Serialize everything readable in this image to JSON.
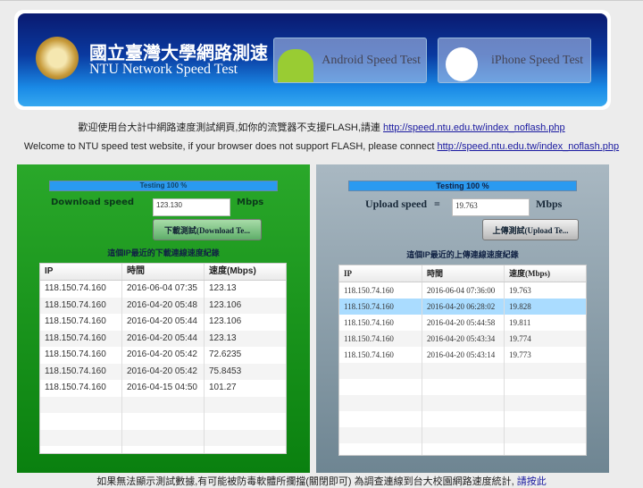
{
  "banner": {
    "title_zh": "國立臺灣大學網路測速",
    "title_en": "NTU Network Speed Test",
    "android": "Android Speed Test",
    "iphone": "iPhone Speed Test"
  },
  "notice": {
    "zh": "歡迎使用台大計中網路速度測試網頁,如你的流覽器不支援FLASH,請連 ",
    "en": "Welcome to NTU speed test website, if your browser does not support FLASH, please connect ",
    "link": "http://speed.ntu.edu.tw/index_noflash.php"
  },
  "download": {
    "progress_text": "Testing 100 %",
    "progress": 100,
    "label": "Download speed",
    "value": "123.130",
    "unit": "Mbps",
    "button": "下載測試(Download Te...",
    "caption": "這個IP最近的下載連線速度紀錄",
    "columns": [
      "IP",
      "時間",
      "速度(Mbps)"
    ],
    "rows": [
      [
        "118.150.74.160",
        "2016-06-04 07:35",
        "123.13"
      ],
      [
        "118.150.74.160",
        "2016-04-20 05:48",
        "123.106"
      ],
      [
        "118.150.74.160",
        "2016-04-20 05:44",
        "123.106"
      ],
      [
        "118.150.74.160",
        "2016-04-20 05:44",
        "123.13"
      ],
      [
        "118.150.74.160",
        "2016-04-20 05:42",
        "72.6235"
      ],
      [
        "118.150.74.160",
        "2016-04-20 05:42",
        "75.8453"
      ],
      [
        "118.150.74.160",
        "2016-04-15 04:50",
        "101.27"
      ]
    ]
  },
  "upload": {
    "progress_text": "Testing 100 %",
    "progress": 100,
    "label": "Upload speed",
    "eq": "=",
    "value": "19.763",
    "unit": "Mbps",
    "button": "上傳測試(Upload Te...",
    "caption": "這個IP最近的上傳連線速度紀錄",
    "columns": [
      "IP",
      "時間",
      "速度(Mbps)"
    ],
    "rows": [
      [
        "118.150.74.160",
        "2016-06-04 07:36:00",
        "19.763"
      ],
      [
        "118.150.74.160",
        "2016-04-20 06:28:02",
        "19.828"
      ],
      [
        "118.150.74.160",
        "2016-04-20 05:44:58",
        "19.811"
      ],
      [
        "118.150.74.160",
        "2016-04-20 05:43:34",
        "19.774"
      ],
      [
        "118.150.74.160",
        "2016-04-20 05:43:14",
        "19.773"
      ]
    ],
    "selected_row": 1
  },
  "footer": {
    "text": "如果無法顯示測試數據,有可能被防毒軟體所攔擋(關閉即可) 為調查連線到台大校園網路速度統計, ",
    "link": "請按此"
  }
}
